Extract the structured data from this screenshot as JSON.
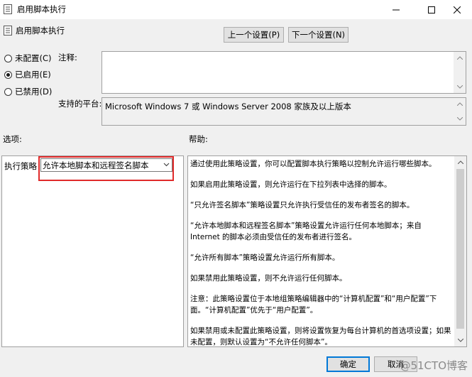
{
  "window": {
    "title": "启用脚本执行",
    "controls": {
      "minimize_icon": "minimize-icon",
      "maximize_icon": "maximize-icon",
      "close_icon": "close-icon"
    }
  },
  "header": {
    "setting_name": "启用脚本执行",
    "prev_button": "上一个设置(P)",
    "next_button": "下一个设置(N)"
  },
  "state_options": [
    {
      "label": "未配置(C)",
      "checked": false
    },
    {
      "label": "已启用(E)",
      "checked": true
    },
    {
      "label": "已禁用(D)",
      "checked": false
    }
  ],
  "comment": {
    "label": "注释:",
    "value": ""
  },
  "platform": {
    "label": "支持的平台:",
    "value": "Microsoft Windows 7 或 Windows Server 2008 家族及以上版本"
  },
  "options": {
    "label": "选项:",
    "policy_label": "执行策略",
    "policy_value": "允许本地脚本和远程签名脚本"
  },
  "help": {
    "label": "帮助:",
    "paragraphs": [
      "通过使用此策略设置，你可以配置脚本执行策略以控制允许运行哪些脚本。",
      "如果启用此策略设置，则允许运行在下拉列表中选择的脚本。",
      "“只允许签名脚本”策略设置只允许执行受信任的发布者签名的脚本。",
      "“允许本地脚本和远程签名脚本”策略设置允许运行任何本地脚本；来自 Internet 的脚本必须由受信任的发布者进行签名。",
      "“允许所有脚本”策略设置允许运行所有脚本。",
      "如果禁用此策略设置，则不允许运行任何脚本。",
      "注意：此策略设置位于本地组策略编辑器中的“计算机配置”和“用户配置”下面。“计算机配置”优先于“用户配置”。",
      "如果禁用或未配置此策略设置，则将设置恢复为每台计算机的首选项设置；如果未配置，则默认设置为“不允许任何脚本”。"
    ]
  },
  "footer": {
    "ok": "确定",
    "cancel": "取消",
    "watermark": "@51CTO博客"
  },
  "colors": {
    "background": "#f0f0f0",
    "highlight_border": "#e02a2a"
  }
}
